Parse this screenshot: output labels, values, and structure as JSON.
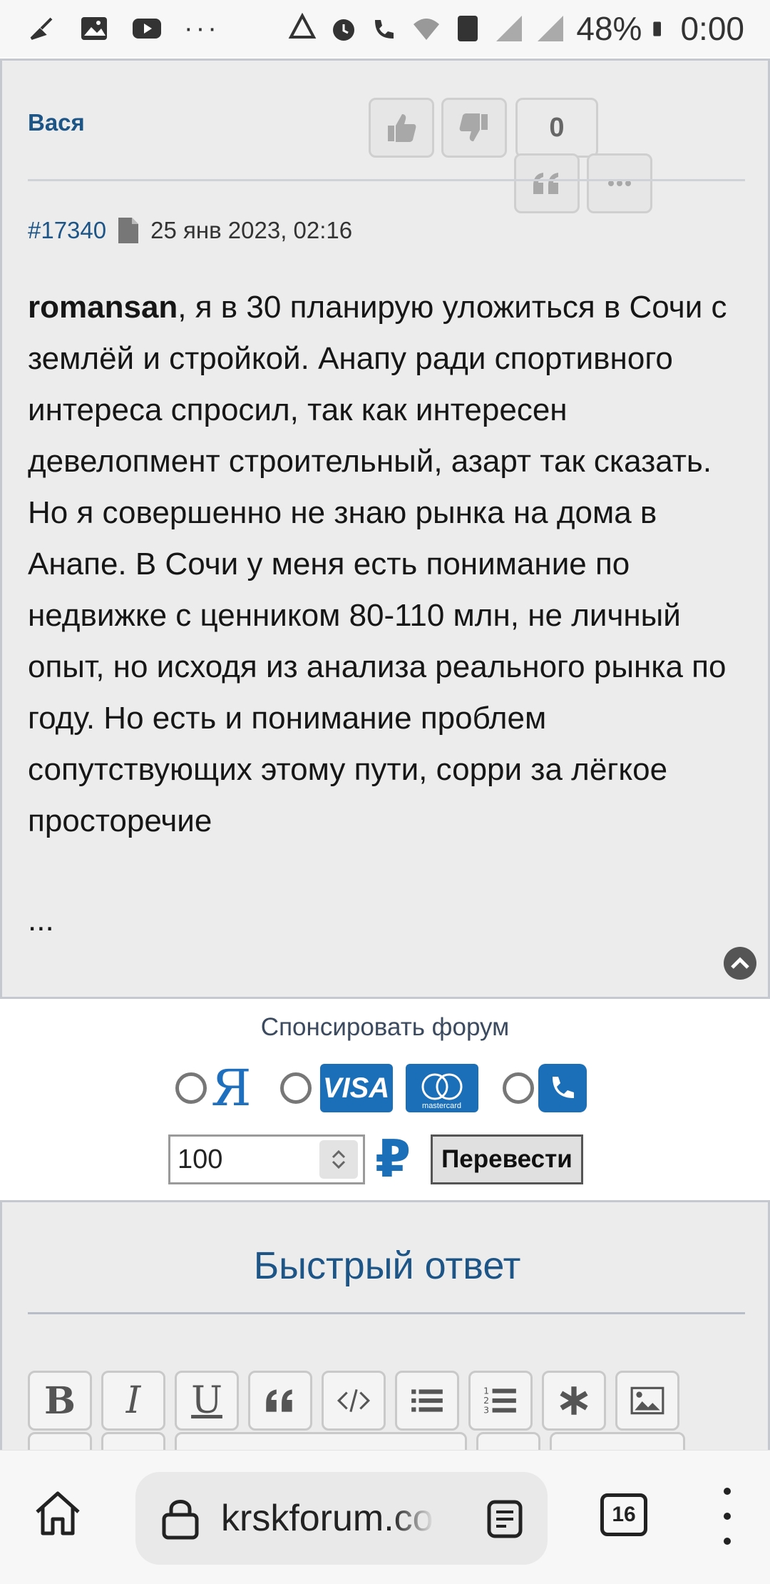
{
  "status_bar": {
    "battery": "48%",
    "time": "0:00",
    "overflow": "···"
  },
  "post": {
    "author": "Вася",
    "vote_count": "0",
    "post_number": "#17340",
    "date": "25 янв 2023, 02:16",
    "mention": "romansan",
    "body": ", я в 30 планирую уложиться в Сочи с землёй и стройкой. Анапу ради спортивного интереса спросил, так как интересен девелопмент строительный, азарт так сказать. Но я совершенно не знаю рынка на дома в Анапе. В Сочи у меня есть понимание по недвижке с ценником 80-110 млн, не личный опыт, но исходя из анализа реального рынка по году. Но есть и понимание проблем сопутствующих этому пути, сорри за лёгкое просторечие",
    "ellipsis": "..."
  },
  "sponsor": {
    "title": "Спонсировать форум",
    "yandex_label": "Я",
    "visa_label": "VISA",
    "mastercard_label": "mastercard",
    "amount_value": "100",
    "currency_symbol": "₽",
    "transfer_label": "Перевести"
  },
  "quick_reply": {
    "title": "Быстрый ответ",
    "toolbar": [
      "B",
      "I",
      "U",
      "quote",
      "code",
      "list",
      "numbered-list",
      "asterisk",
      "image"
    ]
  },
  "browser": {
    "url": "krskforum.com",
    "tab_count": "16"
  },
  "colors": {
    "accent": "#1d5587",
    "pay_blue": "#1a6fb8",
    "post_bg": "#ececec"
  }
}
